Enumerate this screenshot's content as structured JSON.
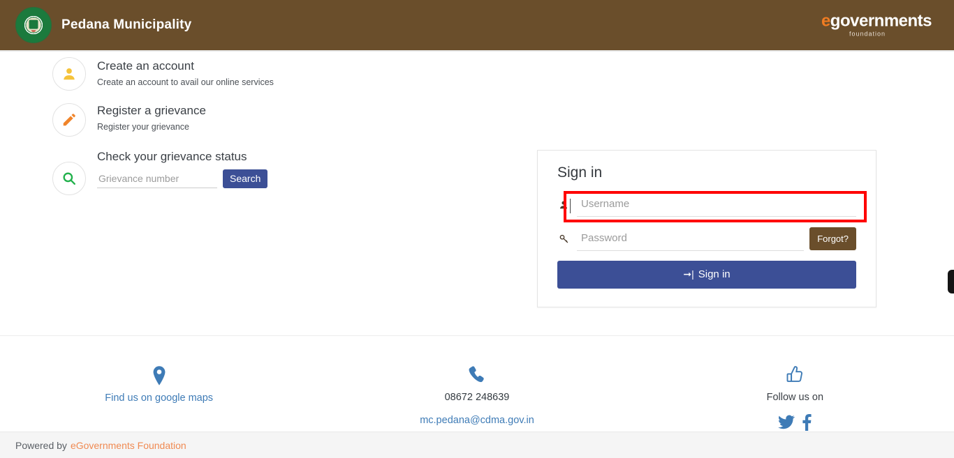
{
  "header": {
    "municipality_title": "Pedana Municipality",
    "emblem_name": "andhra-pradesh-government-emblem",
    "logo": {
      "e": "e",
      "word": "governments",
      "sub": "foundation"
    },
    "brand_color": "#6a4e2b",
    "logo_accent": "#f07c22"
  },
  "features": [
    {
      "icon": "user-icon",
      "icon_color": "#f5c33b",
      "title": "Create an account",
      "subtitle": "Create an account to avail our online services"
    },
    {
      "icon": "pencil-icon",
      "icon_color": "#f0842a",
      "title": "Register a grievance",
      "subtitle": "Register your grievance"
    },
    {
      "icon": "search-icon",
      "icon_color": "#22b14c",
      "title": "Check your grievance status",
      "input_placeholder": "Grievance number",
      "input_value": "",
      "button_label": "Search"
    }
  ],
  "signin": {
    "title": "Sign in",
    "username_placeholder": "Username",
    "username_value": "",
    "password_placeholder": "Password",
    "password_value": "",
    "forgot_label": "Forgot?",
    "signin_label": "Sign in",
    "signin_icon": "sign-in-arrow-icon",
    "accent_color": "#3c4f96",
    "highlight_color": "#ff0000"
  },
  "footer_links": [
    {
      "icon": "map-marker-icon",
      "link_label": "Find us on google maps"
    },
    {
      "icon": "phone-icon",
      "phone": "08672 248639",
      "email": "mc.pedana@cdma.gov.in"
    },
    {
      "icon": "thumbs-up-icon",
      "label": "Follow us on",
      "socials": [
        "twitter-icon",
        "facebook-icon"
      ]
    }
  ],
  "powered": {
    "prefix": "Powered by",
    "link": "eGovernments Foundation"
  }
}
